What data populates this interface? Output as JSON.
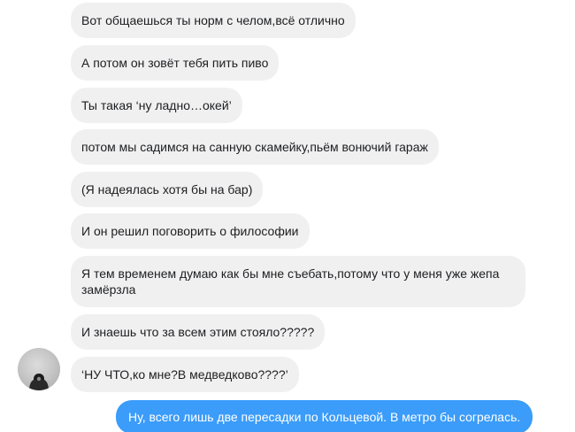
{
  "messages": [
    {
      "text": "Вот общаешься ты норм с челом,всё отлично",
      "direction": "incoming"
    },
    {
      "text": "А потом он зовёт тебя пить пиво",
      "direction": "incoming"
    },
    {
      "text": "Ты такая ‘ну ладно…окей’",
      "direction": "incoming"
    },
    {
      "text": "потом мы садимся на санную скамейку,пьём вонючий гараж",
      "direction": "incoming"
    },
    {
      "text": "(Я надеялась хотя бы на бар)",
      "direction": "incoming"
    },
    {
      "text": "И он решил поговорить о философии",
      "direction": "incoming"
    },
    {
      "text": "Я тем временем думаю как бы мне съебать,потому что у меня уже жепа замёрзла",
      "direction": "incoming"
    },
    {
      "text": "И знаешь что за всем этим стояло?????",
      "direction": "incoming"
    },
    {
      "text": "‘НУ ЧТО,ко мне?В медведково????’",
      "direction": "incoming"
    },
    {
      "text": "Ну, всего лишь две пересадки по Кольцевой. В метро бы согрелась.",
      "direction": "outgoing"
    }
  ],
  "colors": {
    "incoming_bg": "#f1f0f0",
    "outgoing_bg": "#3b9cf9",
    "incoming_text": "#1c1e21",
    "outgoing_text": "#ffffff"
  },
  "icons": {
    "avatar": "contact-avatar"
  }
}
